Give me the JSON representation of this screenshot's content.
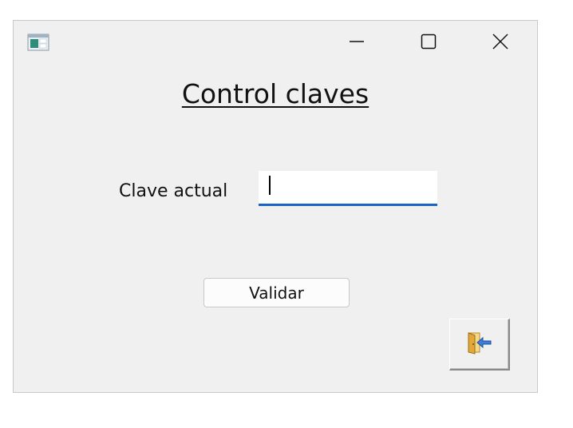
{
  "window": {
    "title": "Control claves"
  },
  "form": {
    "label": "Clave actual",
    "input_value": "",
    "validate_button": "Validar"
  },
  "icons": {
    "app": "app-window-icon",
    "minimize": "minimize-icon",
    "maximize": "maximize-icon",
    "close": "close-icon",
    "exit": "exit-door-icon"
  },
  "colors": {
    "window_bg": "#f0f0f0",
    "input_focus_border": "#1a63c7"
  }
}
